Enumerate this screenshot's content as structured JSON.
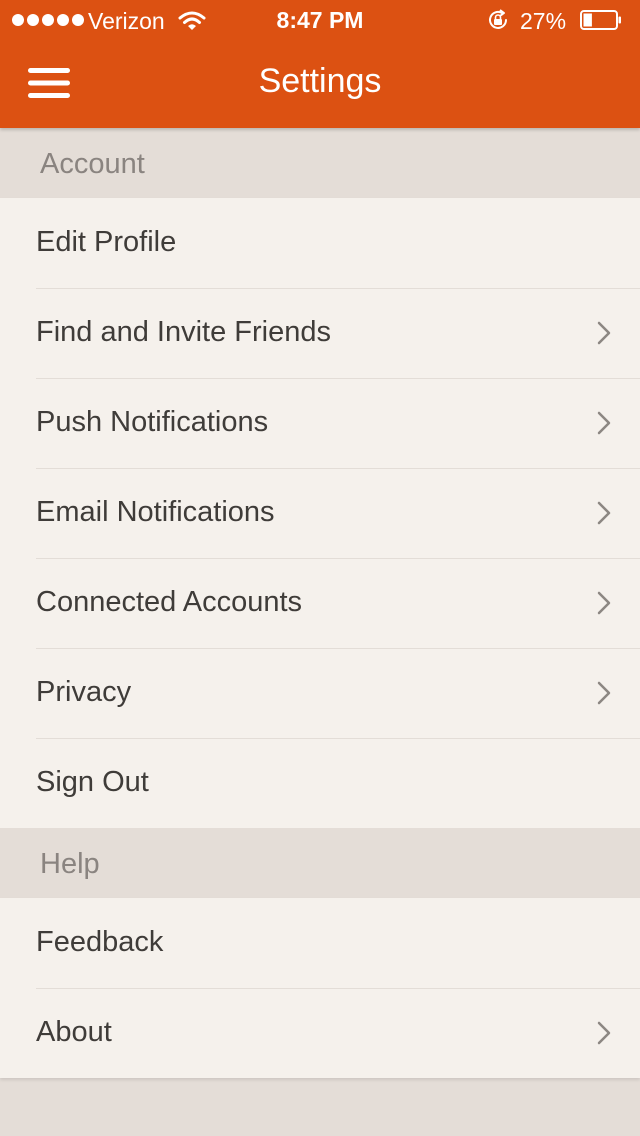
{
  "status_bar": {
    "carrier": "Verizon",
    "time": "8:47 PM",
    "battery_percent": "27%",
    "battery_level": 0.27
  },
  "header": {
    "title": "Settings",
    "menu_icon": "hamburger-menu-icon",
    "color": "#dc5112"
  },
  "sections": [
    {
      "title": "Account",
      "items": [
        {
          "label": "Edit Profile",
          "chevron": false
        },
        {
          "label": "Find and Invite Friends",
          "chevron": true
        },
        {
          "label": "Push Notifications",
          "chevron": true
        },
        {
          "label": "Email Notifications",
          "chevron": true
        },
        {
          "label": "Connected Accounts",
          "chevron": true
        },
        {
          "label": "Privacy",
          "chevron": true
        },
        {
          "label": "Sign Out",
          "chevron": false
        }
      ]
    },
    {
      "title": "Help",
      "items": [
        {
          "label": "Feedback",
          "chevron": false
        },
        {
          "label": "About",
          "chevron": true
        }
      ]
    }
  ],
  "colors": {
    "accent": "#dc5112",
    "section_background": "#e4ddd7",
    "row_background": "#f5f1ec",
    "row_text": "#3f3c39",
    "section_text": "#8a8480"
  }
}
